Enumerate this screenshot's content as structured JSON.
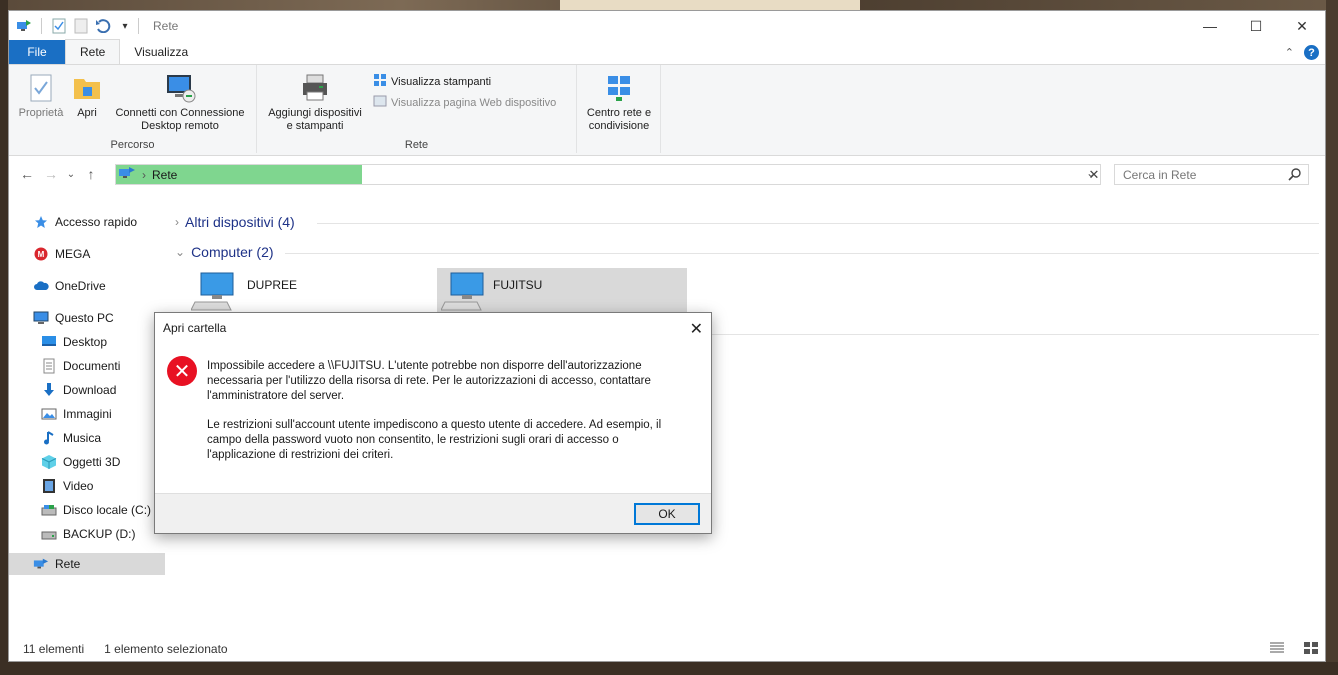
{
  "window": {
    "title": "Rete"
  },
  "ribbon": {
    "tabs": [
      {
        "label": "File"
      },
      {
        "label": "Rete"
      },
      {
        "label": "Visualizza"
      }
    ],
    "groups": {
      "percorso": {
        "label": "Percorso",
        "proprieta": "Proprietà",
        "apri": "Apri",
        "connetti_line1": "Connetti con Connessione",
        "connetti_line2": "Desktop remoto"
      },
      "rete": {
        "label": "Rete",
        "aggiungi_line1": "Aggiungi dispositivi",
        "aggiungi_line2": "e stampanti",
        "visualizza_stampanti": "Visualizza stampanti",
        "visualizza_pagina": "Visualizza pagina Web dispositivo"
      },
      "centro": {
        "line1": "Centro rete e",
        "line2": "condivisione"
      }
    }
  },
  "address": {
    "path_item": "Rete",
    "search_placeholder": "Cerca in Rete"
  },
  "navpane": {
    "items": [
      {
        "label": "Accesso rapido",
        "icon": "star-icon"
      },
      {
        "label": "MEGA",
        "icon": "mega-icon"
      },
      {
        "label": "OneDrive",
        "icon": "cloud-icon"
      },
      {
        "label": "Questo PC",
        "icon": "computer-icon"
      },
      {
        "label": "Desktop",
        "icon": "desktop-icon"
      },
      {
        "label": "Documenti",
        "icon": "documents-icon"
      },
      {
        "label": "Download",
        "icon": "download-icon"
      },
      {
        "label": "Immagini",
        "icon": "pictures-icon"
      },
      {
        "label": "Musica",
        "icon": "music-icon"
      },
      {
        "label": "Oggetti 3D",
        "icon": "cube-icon"
      },
      {
        "label": "Video",
        "icon": "video-icon"
      },
      {
        "label": "Disco locale (C:)",
        "icon": "drive-icon"
      },
      {
        "label": "BACKUP (D:)",
        "icon": "drive-icon"
      },
      {
        "label": "Rete",
        "icon": "network-icon"
      }
    ]
  },
  "content": {
    "group_altri": "Altri dispositivi (4)",
    "group_computer": "Computer (2)",
    "computers": [
      {
        "name": "DUPREE"
      },
      {
        "name": "FUJITSU"
      }
    ]
  },
  "status": {
    "count": "11 elementi",
    "selected": "1 elemento selezionato"
  },
  "dialog": {
    "title": "Apri cartella",
    "paragraph1_line1": "Impossibile accedere a \\\\FUJITSU. L'utente potrebbe non disporre dell'autorizzazione",
    "paragraph1_line2": "necessaria per l'utilizzo della risorsa di rete. Per le autorizzazioni di accesso, contattare",
    "paragraph1_line3": "l'amministratore del server.",
    "paragraph2_line1": "Le restrizioni sull'account utente impediscono a questo utente di accedere. Ad esempio, il",
    "paragraph2_line2": "campo della password vuoto non consentito, le restrizioni sugli orari di accesso o",
    "paragraph2_line3": "l'applicazione di restrizioni dei criteri.",
    "ok_label": "OK"
  },
  "colors": {
    "accent": "#1a6fc4",
    "address_highlight": "#7fd68f",
    "error": "#e81123",
    "group_header": "#1e3287"
  }
}
